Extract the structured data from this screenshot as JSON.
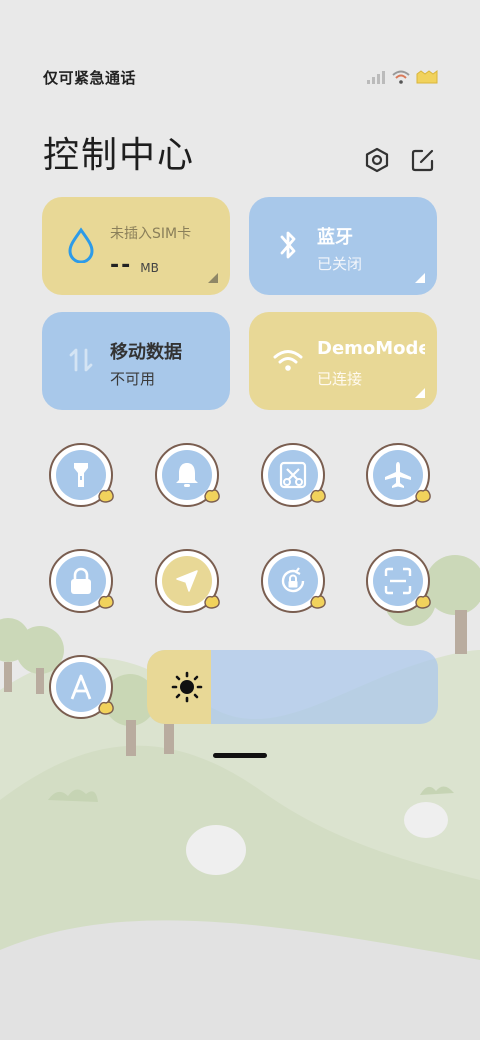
{
  "status_bar": {
    "carrier_text": "仅可紧急通话",
    "icons": [
      "signal-icon",
      "wifi-icon",
      "battery-icon"
    ]
  },
  "header": {
    "title": "控制中心",
    "settings_icon": "gear-icon",
    "edit_icon": "edit-icon"
  },
  "tiles": {
    "data": {
      "label": "未插入SIM卡",
      "value": "--",
      "unit": "MB",
      "icon": "water-drop-icon"
    },
    "bluetooth": {
      "label": "蓝牙",
      "status": "已关闭",
      "icon": "bluetooth-icon"
    },
    "mobile_data": {
      "label": "移动数据",
      "status": "不可用",
      "icon": "data-arrows-icon"
    },
    "wifi": {
      "label": "DemoMode",
      "status": "已连接",
      "icon": "wifi-icon"
    }
  },
  "toggles": [
    {
      "name": "flashlight",
      "icon": "flashlight-icon",
      "on": false
    },
    {
      "name": "sound",
      "icon": "bell-icon",
      "on": false
    },
    {
      "name": "screenshot",
      "icon": "scissors-icon",
      "on": false
    },
    {
      "name": "airplane-mode",
      "icon": "airplane-icon",
      "on": false
    },
    {
      "name": "lock-screen",
      "icon": "lock-icon",
      "on": false
    },
    {
      "name": "location",
      "icon": "location-arrow-icon",
      "on": true
    },
    {
      "name": "auto-rotate",
      "icon": "rotate-lock-icon",
      "on": false
    },
    {
      "name": "scanner",
      "icon": "scan-icon",
      "on": false
    },
    {
      "name": "auto-brightness",
      "icon": "letter-a-icon",
      "on": false
    }
  ],
  "brightness": {
    "level": 0.22,
    "icon": "sun-icon"
  },
  "colors": {
    "yellow_tile": "#e8d896",
    "blue_tile": "#a8c8ea",
    "background": "#e9e9e9",
    "ring_border": "#7a5e50"
  }
}
